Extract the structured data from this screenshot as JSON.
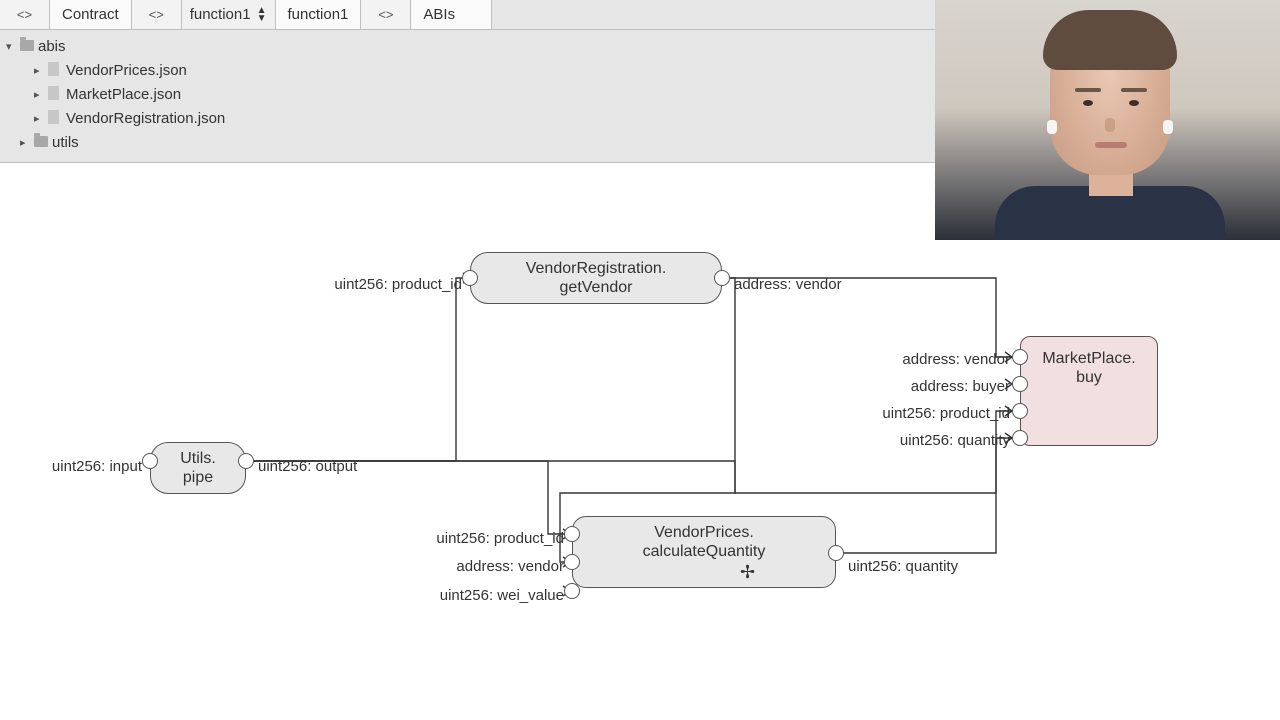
{
  "toolbar": {
    "tab1_icon": "<>",
    "tab1_label": "Contract",
    "tab2_icon": "<>",
    "tab2_select": "function1",
    "tab2_label": "function1",
    "tab3_icon": "<>",
    "tab3_label": "ABIs"
  },
  "tree": {
    "root": "abis",
    "files": [
      "VendorPrices.json",
      "MarketPlace.json",
      "VendorRegistration.json"
    ],
    "folder2": "utils"
  },
  "nodes": {
    "utils": {
      "line1": "Utils.",
      "line2": "pipe"
    },
    "getVendor": {
      "line1": "VendorRegistration.",
      "line2": "getVendor"
    },
    "calcQty": {
      "line1": "VendorPrices.",
      "line2": "calculateQuantity"
    },
    "buy": {
      "line1": "MarketPlace.",
      "line2": "buy"
    }
  },
  "ports": {
    "utils_in": "uint256: input",
    "utils_out": "uint256: output",
    "gv_in": "uint256: product_id",
    "gv_out": "address: vendor",
    "cq_in1": "uint256: product_id",
    "cq_in2": "address: vendor",
    "cq_in3": "uint256: wei_value",
    "cq_out": "uint256: quantity",
    "buy_in1": "address: vendor",
    "buy_in2": "address: buyer",
    "buy_in3": "uint256: product_id",
    "buy_in4": "uint256: quantity"
  }
}
